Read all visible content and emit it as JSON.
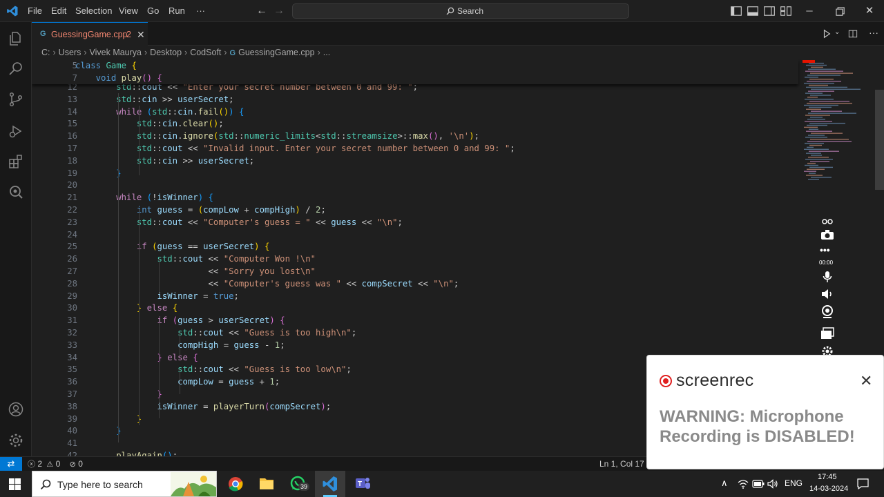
{
  "titlebar": {
    "menu": [
      "File",
      "Edit",
      "Selection",
      "View",
      "Go",
      "Run",
      "···"
    ],
    "search_placeholder": "Search"
  },
  "tab": {
    "filename": "GuessingGame.cpp",
    "problems": "2",
    "close": "✕"
  },
  "breadcrumb": [
    "C:",
    "Users",
    "Vivek Maurya",
    "Desktop",
    "CodSoft",
    "GuessingGame.cpp",
    "..."
  ],
  "sticky": [
    {
      "ln": "5",
      "html": "<span class='kw'>class</span> <span class='ty'>Game</span> <span class='b1'>{</span>"
    },
    {
      "ln": "7",
      "html": "    <span class='kw'>void</span> <span class='fn'>play</span><span class='b2'>()</span> <span class='b2'>{</span>"
    }
  ],
  "code_lines": [
    {
      "ln": "12",
      "html": "        <span class='ns'>std</span>::<span class='var'>cout</span> &lt;&lt; <span class='str'>\"Enter your secret number between 0 and 99: \"</span>;"
    },
    {
      "ln": "13",
      "html": "        <span class='ns'>std</span>::<span class='var'>cin</span> &gt;&gt; <span class='var'>userSecret</span>;"
    },
    {
      "ln": "14",
      "html": "        <span class='ctl'>while</span> <span class='b3'>(</span><span class='ns'>std</span>::<span class='var'>cin</span>.<span class='fn'>fail</span><span class='b1'>()</span><span class='b3'>)</span> <span class='b3'>{</span>"
    },
    {
      "ln": "15",
      "html": "            <span class='ns'>std</span>::<span class='var'>cin</span>.<span class='fn'>clear</span><span class='b1'>()</span>;"
    },
    {
      "ln": "16",
      "html": "            <span class='ns'>std</span>::<span class='var'>cin</span>.<span class='fn'>ignore</span><span class='b1'>(</span><span class='ns'>std</span>::<span class='ty'>numeric_limits</span>&lt;<span class='ns'>std</span>::<span class='ty'>streamsize</span>&gt;::<span class='fn'>max</span><span class='b2'>()</span>, <span class='str'>'\\n'</span><span class='b1'>)</span>;"
    },
    {
      "ln": "17",
      "html": "            <span class='ns'>std</span>::<span class='var'>cout</span> &lt;&lt; <span class='str'>\"Invalid input. Enter your secret number between 0 and 99: \"</span>;"
    },
    {
      "ln": "18",
      "html": "            <span class='ns'>std</span>::<span class='var'>cin</span> &gt;&gt; <span class='var'>userSecret</span>;"
    },
    {
      "ln": "19",
      "html": "        <span class='b3'>}</span>"
    },
    {
      "ln": "20",
      "html": ""
    },
    {
      "ln": "21",
      "html": "        <span class='ctl'>while</span> <span class='b3'>(</span>!<span class='var'>isWinner</span><span class='b3'>)</span> <span class='b3'>{</span>"
    },
    {
      "ln": "22",
      "html": "            <span class='kw'>int</span> <span class='var'>guess</span> = <span class='b1'>(</span><span class='var'>compLow</span> + <span class='var'>compHigh</span><span class='b1'>)</span> / <span class='num'>2</span>;"
    },
    {
      "ln": "23",
      "html": "            <span class='ns'>std</span>::<span class='var'>cout</span> &lt;&lt; <span class='str'>\"Computer's guess = \"</span> &lt;&lt; <span class='var'>guess</span> &lt;&lt; <span class='str'>\"\\n\"</span>;"
    },
    {
      "ln": "24",
      "html": ""
    },
    {
      "ln": "25",
      "html": "            <span class='ctl'>if</span> <span class='b1'>(</span><span class='var'>guess</span> == <span class='var'>userSecret</span><span class='b1'>)</span> <span class='b1'>{</span>"
    },
    {
      "ln": "26",
      "html": "                <span class='ns'>std</span>::<span class='var'>cout</span> &lt;&lt; <span class='str'>\"Computer Won !\\n\"</span>"
    },
    {
      "ln": "27",
      "html": "                          &lt;&lt; <span class='str'>\"Sorry you lost\\n\"</span>"
    },
    {
      "ln": "28",
      "html": "                          &lt;&lt; <span class='str'>\"Computer's guess was \"</span> &lt;&lt; <span class='var'>compSecret</span> &lt;&lt; <span class='str'>\"\\n\"</span>;"
    },
    {
      "ln": "29",
      "html": "                <span class='var'>isWinner</span> = <span class='kw'>true</span>;"
    },
    {
      "ln": "30",
      "html": "            <span class='b1'>}</span> <span class='ctl'>else</span> <span class='b1'>{</span>"
    },
    {
      "ln": "31",
      "html": "                <span class='ctl'>if</span> <span class='b2'>(</span><span class='var'>guess</span> &gt; <span class='var'>userSecret</span><span class='b2'>)</span> <span class='b2'>{</span>"
    },
    {
      "ln": "32",
      "html": "                    <span class='ns'>std</span>::<span class='var'>cout</span> &lt;&lt; <span class='str'>\"Guess is too high\\n\"</span>;"
    },
    {
      "ln": "33",
      "html": "                    <span class='var'>compHigh</span> = <span class='var'>guess</span> - <span class='num'>1</span>;"
    },
    {
      "ln": "34",
      "html": "                <span class='b2'>}</span> <span class='ctl'>else</span> <span class='b2'>{</span>"
    },
    {
      "ln": "35",
      "html": "                    <span class='ns'>std</span>::<span class='var'>cout</span> &lt;&lt; <span class='str'>\"Guess is too low\\n\"</span>;"
    },
    {
      "ln": "36",
      "html": "                    <span class='var'>compLow</span> = <span class='var'>guess</span> + <span class='num'>1</span>;"
    },
    {
      "ln": "37",
      "html": "                <span class='b2'>}</span>"
    },
    {
      "ln": "38",
      "html": "                <span class='var'>isWinner</span> = <span class='fn'>playerTurn</span><span class='b2'>(</span><span class='var'>compSecret</span><span class='b2'>)</span>;"
    },
    {
      "ln": "39",
      "html": "            <span class='b1'>}</span>"
    },
    {
      "ln": "40",
      "html": "        <span class='b3'>}</span>"
    },
    {
      "ln": "41",
      "html": ""
    },
    {
      "ln": "42",
      "html": "        <span class='fn'>playAgain</span><span class='b3'>()</span>;"
    }
  ],
  "statusbar": {
    "errors": "2",
    "warnings": "0",
    "info": "0",
    "position": "Ln 1, Col 17"
  },
  "screenrec": {
    "brand": "screenrec",
    "warning": "WARNING: Microphone Recording is DISABLED!",
    "timer": "00:00"
  },
  "taskbar": {
    "search_placeholder": "Type here to search",
    "whatsapp_badge": "39",
    "language": "ENG",
    "time": "17:45",
    "date": "14-03-2024"
  },
  "colors": {
    "accent": "#0078d4",
    "tab_error": "#f48771",
    "rec_red": "#e02020"
  }
}
